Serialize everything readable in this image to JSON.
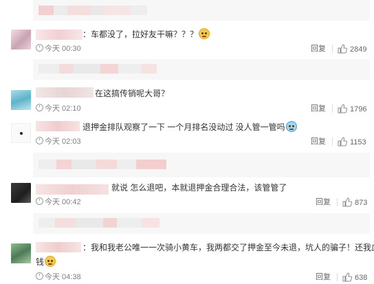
{
  "comments": [
    {
      "text": "：车都没了，拉好友干嘛？？？",
      "time": "今天 00:30",
      "reply_label": "回复",
      "likes": "2849",
      "emoji": "sweat-smile-emoji"
    },
    {
      "text": "在这搞传销呢大哥？",
      "time": "今天 02:10",
      "reply_label": "回复",
      "likes": "1796"
    },
    {
      "text": "退押金排队观察了一下 一个月排名没动过 没人管一管吗",
      "time": "今天 02:03",
      "reply_label": "回复",
      "likes": "1153",
      "emoji": "crying-laugh-emoji"
    },
    {
      "text": "就说 怎么退吧，本就退押金合理合法，该管管了",
      "time": "今天 00:42",
      "reply_label": "回复",
      "likes": "873"
    },
    {
      "text": "：我和我老公唯一一次骑小黄车，我两都交了押金至今未退，坑人的骗子！还我血汗",
      "text_line2": "钱",
      "time": "今天 04:38",
      "reply_label": "回复",
      "likes": "638",
      "emoji": "pleading-emoji"
    }
  ],
  "icons": {
    "like": "thumbs-up-icon",
    "time": "clock-icon"
  },
  "colors": {
    "text": "#333333",
    "meta": "#808080",
    "blur_pink": "#f2c8c8",
    "blur_gray": "#e6e6e6"
  }
}
